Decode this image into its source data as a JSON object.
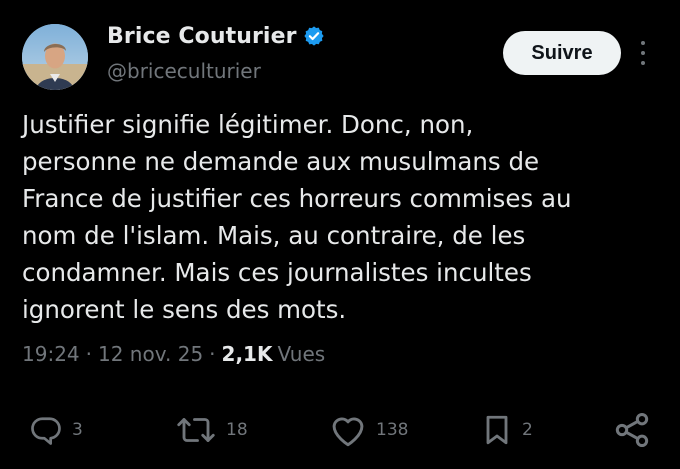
{
  "author": {
    "display_name": "Brice Couturier",
    "handle": "@briceculturier",
    "verified": true,
    "badge_color": "#1d9bf0"
  },
  "header": {
    "follow_label": "Suivre"
  },
  "tweet": {
    "text": "Justifier signifie légitimer. Donc, non,\npersonne ne demande aux musulmans de\nFrance de justifier ces horreurs commises au\nnom de l'islam. Mais, au contraire, de les\ncondamner. Mais ces journalistes incultes\nignorent le sens des mots."
  },
  "meta": {
    "time": "19:24",
    "date": "12 nov. 25",
    "separator": "·",
    "views_count": "2,1K",
    "views_label": "Vues"
  },
  "actions": {
    "reply": {
      "icon": "reply-icon",
      "count": "3"
    },
    "repost": {
      "icon": "repost-icon",
      "count": "18"
    },
    "like": {
      "icon": "heart-icon",
      "count": "138"
    },
    "bookmark": {
      "icon": "bookmark-icon",
      "count": "2"
    },
    "share": {
      "icon": "share-icon"
    }
  },
  "colors": {
    "background": "#000000",
    "text_primary": "#e7e9ea",
    "text_secondary": "#71767b",
    "follow_bg": "#eff3f4"
  }
}
